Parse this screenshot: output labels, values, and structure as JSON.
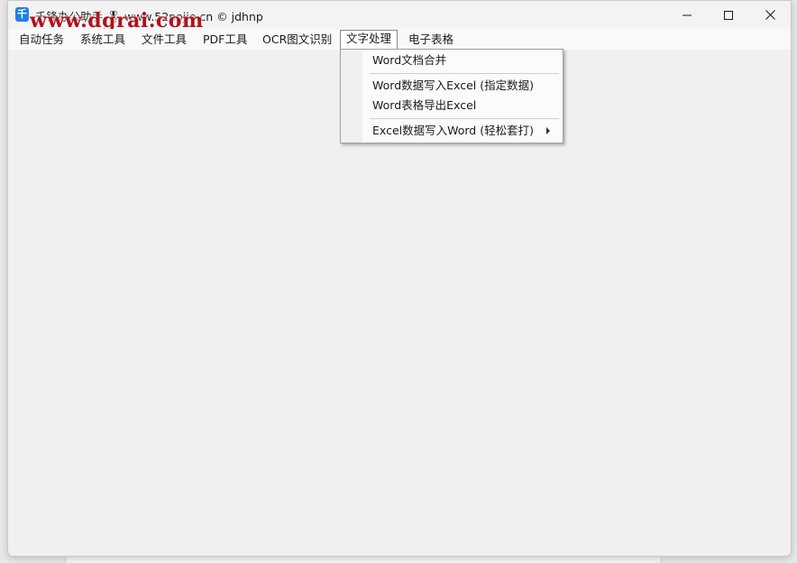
{
  "window": {
    "title": "千锋办公助手  🎖 www.52pojie.cn © jdhnp",
    "watermark": "www.dgrai.com",
    "controls": {
      "minimize": "minimize",
      "maximize": "maximize",
      "close": "close"
    }
  },
  "menubar": {
    "items": [
      {
        "label": "自动任务"
      },
      {
        "label": "系统工具"
      },
      {
        "label": "文件工具"
      },
      {
        "label": "PDF工具"
      },
      {
        "label": "OCR图文识别"
      },
      {
        "label": "文字处理"
      },
      {
        "label": "电子表格"
      }
    ],
    "active_index": 5
  },
  "dropdown": {
    "groups": [
      [
        {
          "label": "Word文档合并"
        }
      ],
      [
        {
          "label": "Word数据写入Excel (指定数据)"
        },
        {
          "label": "Word表格导出Excel"
        }
      ],
      [
        {
          "label": "Excel数据写入Word (轻松套打)",
          "has_submenu": true
        }
      ]
    ]
  },
  "icons": {
    "app": "app-icon",
    "submenu": "chevron-right-icon"
  },
  "colors": {
    "watermark": "#b0121a",
    "app_icon": "#1f7fe8"
  }
}
